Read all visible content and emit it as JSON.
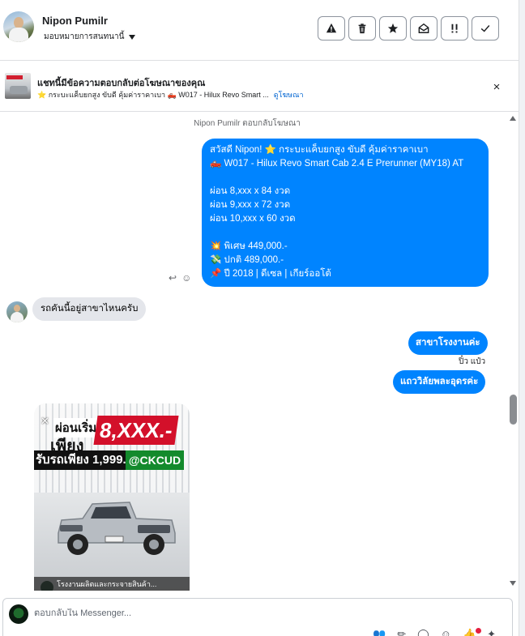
{
  "header": {
    "user_name": "Nipon Pumilr",
    "assign_label": "มอบหมายการสนทนานี้",
    "toolbar_icons": [
      "alert-triangle-icon",
      "trash-icon",
      "star-icon",
      "mark-unread-icon",
      "follow-up-icon",
      "check-icon"
    ],
    "toolbar_glyphs": [
      "⚠",
      "🗑",
      "★",
      "✉",
      "‼",
      "✓"
    ]
  },
  "ad_banner": {
    "title": "แชทนี้มีข้อความตอบกลับต่อโฆษณาของคุณ",
    "subtitle": "⭐ กระบะแค็บยกสูง ขับดี คุ้มค่าราคาเบา 🛻 W017 - Hilux Revo Smart ...",
    "link": "ดูโฆษณา",
    "close": "×"
  },
  "chat": {
    "system_note": "Nipon Pumilr ตอบกลับโฆษณา",
    "outgoing_ad_message": {
      "lines": [
        "สวัสดี Nipon! ⭐ กระบะแค็บยกสูง ขับดี คุ้มค่าราคาเบา",
        "🛻 W017 - Hilux Revo Smart Cab 2.4 E Prerunner (MY18) AT",
        "",
        "ผ่อน 8,xxx x 84 งวด",
        "ผ่อน 9,xxx x 72 งวด",
        "ผ่อน 10,xxx x 60 งวด",
        "",
        "💥 พิเศษ 449,000.-",
        "💸 ปกติ 489,000.-",
        "📌 ปี 2018 | ดีเซล | เกียร์ออโต้"
      ]
    },
    "message_actions": {
      "reply": "↩",
      "react": "☺"
    },
    "incoming_message": "รถคันนี้อยู่สาขาไหนครับ",
    "reply_1": "สาขาโรงงานค่ะ",
    "sender_tag": "ปิ๋ว แป๋ว",
    "reply_2": "แถววิลัยพละอุดรค่ะ",
    "image_card": {
      "line1": "ผ่อนเริ่มต้น",
      "price": "8,XXX.-",
      "line2": "เพียง",
      "line3": "รับรถเพียง 1,999.-",
      "code": "@CKCUD",
      "caption": "โรงงานผลิตและกระจายสินค้า..."
    }
  },
  "composer": {
    "placeholder": "ตอบกลับใน Messenger...",
    "tools": [
      "👥",
      "✏",
      "◯",
      "☺",
      "👍",
      "✦"
    ]
  },
  "colors": {
    "accent": "#0084ff",
    "incoming_bubble": "#e4e6eb",
    "link": "#0064d1"
  }
}
